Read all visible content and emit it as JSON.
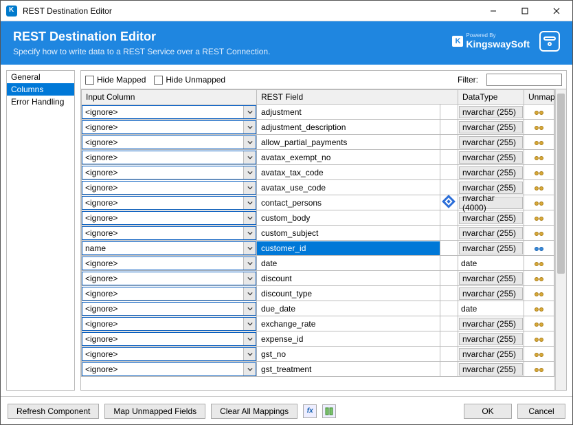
{
  "window": {
    "title": "REST Destination Editor"
  },
  "header": {
    "title": "REST Destination Editor",
    "subtitle": "Specify how to write data to a REST Service over a REST Connection.",
    "brand_powered": "Powered By",
    "brand_name": "KingswaySoft",
    "brand_k": "K"
  },
  "sidebar": {
    "items": [
      {
        "label": "General",
        "selected": false
      },
      {
        "label": "Columns",
        "selected": true
      },
      {
        "label": "Error Handling",
        "selected": false
      }
    ]
  },
  "toolbar": {
    "hide_mapped_label": "Hide Mapped",
    "hide_unmapped_label": "Hide Unmapped",
    "filter_label": "Filter:",
    "filter_value": ""
  },
  "grid": {
    "columns": {
      "input": "Input Column",
      "rest": "REST Field",
      "datatype": "DataType",
      "unmap": "Unmap"
    },
    "rows": [
      {
        "input": "<ignore>",
        "rest": "adjustment",
        "datatype": "nvarchar (255)",
        "datatype_boxed": true
      },
      {
        "input": "<ignore>",
        "rest": "adjustment_description",
        "datatype": "nvarchar (255)",
        "datatype_boxed": true
      },
      {
        "input": "<ignore>",
        "rest": "allow_partial_payments",
        "datatype": "nvarchar (255)",
        "datatype_boxed": true
      },
      {
        "input": "<ignore>",
        "rest": "avatax_exempt_no",
        "datatype": "nvarchar (255)",
        "datatype_boxed": true
      },
      {
        "input": "<ignore>",
        "rest": "avatax_tax_code",
        "datatype": "nvarchar (255)",
        "datatype_boxed": true
      },
      {
        "input": "<ignore>",
        "rest": "avatax_use_code",
        "datatype": "nvarchar (255)",
        "datatype_boxed": true
      },
      {
        "input": "<ignore>",
        "rest": "contact_persons",
        "datatype": "nvarchar (4000)",
        "datatype_boxed": true,
        "flag": true
      },
      {
        "input": "<ignore>",
        "rest": "custom_body",
        "datatype": "nvarchar (255)",
        "datatype_boxed": true
      },
      {
        "input": "<ignore>",
        "rest": "custom_subject",
        "datatype": "nvarchar (255)",
        "datatype_boxed": true
      },
      {
        "input": "name",
        "rest": "customer_id",
        "datatype": "nvarchar (255)",
        "datatype_boxed": true,
        "selected": true
      },
      {
        "input": "<ignore>",
        "rest": "date",
        "datatype": "date",
        "datatype_boxed": false
      },
      {
        "input": "<ignore>",
        "rest": "discount",
        "datatype": "nvarchar (255)",
        "datatype_boxed": true
      },
      {
        "input": "<ignore>",
        "rest": "discount_type",
        "datatype": "nvarchar (255)",
        "datatype_boxed": true
      },
      {
        "input": "<ignore>",
        "rest": "due_date",
        "datatype": "date",
        "datatype_boxed": false
      },
      {
        "input": "<ignore>",
        "rest": "exchange_rate",
        "datatype": "nvarchar (255)",
        "datatype_boxed": true
      },
      {
        "input": "<ignore>",
        "rest": "expense_id",
        "datatype": "nvarchar (255)",
        "datatype_boxed": true
      },
      {
        "input": "<ignore>",
        "rest": "gst_no",
        "datatype": "nvarchar (255)",
        "datatype_boxed": true
      },
      {
        "input": "<ignore>",
        "rest": "gst_treatment",
        "datatype": "nvarchar (255)",
        "datatype_boxed": true
      }
    ]
  },
  "footer": {
    "refresh": "Refresh Component",
    "map_unmapped": "Map Unmapped Fields",
    "clear_all": "Clear All Mappings",
    "fx": "fx",
    "ok": "OK",
    "cancel": "Cancel"
  }
}
